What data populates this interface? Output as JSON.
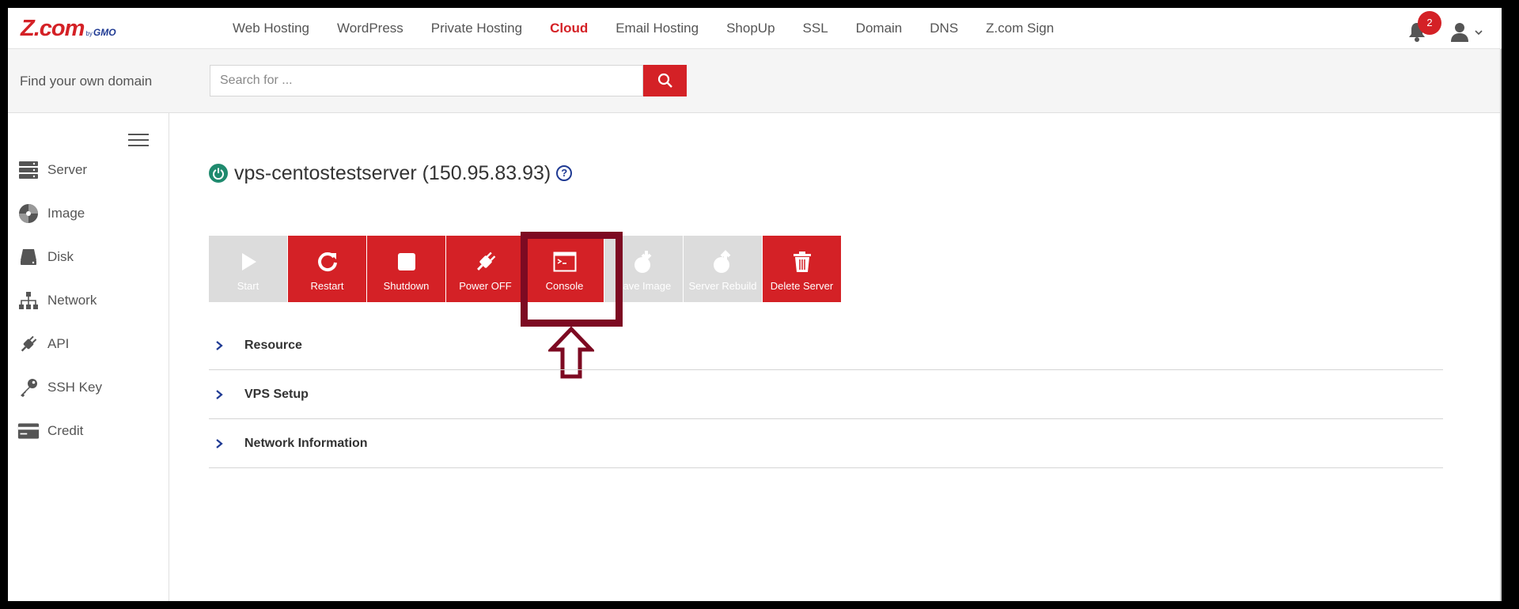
{
  "brand": {
    "main": "Z.com",
    "by": "by",
    "gmo": "GMO"
  },
  "nav": {
    "items": [
      {
        "label": "Web Hosting",
        "active": false
      },
      {
        "label": "WordPress",
        "active": false
      },
      {
        "label": "Private Hosting",
        "active": false
      },
      {
        "label": "Cloud",
        "active": true
      },
      {
        "label": "Email Hosting",
        "active": false
      },
      {
        "label": "ShopUp",
        "active": false
      },
      {
        "label": "SSL",
        "active": false
      },
      {
        "label": "Domain",
        "active": false
      },
      {
        "label": "DNS",
        "active": false
      },
      {
        "label": "Z.com Sign",
        "active": false
      }
    ],
    "notification_count": "2",
    "icons": {
      "notifications": "bell-icon",
      "user": "user-icon"
    }
  },
  "search": {
    "label": "Find your own domain",
    "placeholder": "Search for ...",
    "value": "",
    "button_icon": "search-icon"
  },
  "sidebar": {
    "items": [
      {
        "label": "Server",
        "icon": "server-icon"
      },
      {
        "label": "Image",
        "icon": "disc-icon"
      },
      {
        "label": "Disk",
        "icon": "disk-icon"
      },
      {
        "label": "Network",
        "icon": "network-icon"
      },
      {
        "label": "API",
        "icon": "plug-icon"
      },
      {
        "label": "SSH Key",
        "icon": "key-icon"
      },
      {
        "label": "Credit",
        "icon": "credit-card-icon"
      }
    ]
  },
  "server": {
    "title": "vps-centostestserver (150.95.83.93)",
    "status": "running"
  },
  "actions": [
    {
      "label": "Start",
      "icon": "play-icon",
      "enabled": false
    },
    {
      "label": "Restart",
      "icon": "restart-icon",
      "enabled": true
    },
    {
      "label": "Shutdown",
      "icon": "stop-icon",
      "enabled": true
    },
    {
      "label": "Power OFF",
      "icon": "plug-icon",
      "enabled": true
    },
    {
      "label": "Console",
      "icon": "console-icon",
      "enabled": true,
      "highlighted": true
    },
    {
      "label": "Save Image",
      "icon": "save-image-icon",
      "enabled": false
    },
    {
      "label": "Server Rebuild",
      "icon": "rebuild-icon",
      "enabled": false
    },
    {
      "label": "Delete Server",
      "icon": "trash-icon",
      "enabled": true
    }
  ],
  "sections": [
    {
      "label": "Resource"
    },
    {
      "label": "VPS Setup"
    },
    {
      "label": "Network Information"
    }
  ],
  "colors": {
    "brand_red": "#d42126",
    "brand_blue": "#1f3a93",
    "status_green": "#1f8a6e",
    "highlight": "#7d0a22",
    "disabled": "#dcdcdc"
  }
}
